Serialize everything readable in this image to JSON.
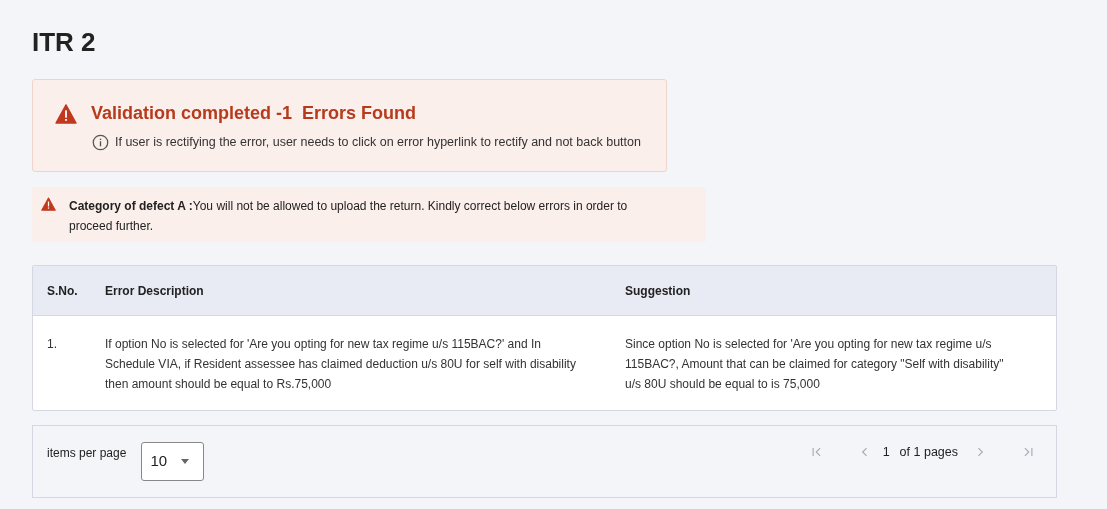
{
  "title": "ITR 2",
  "alert": {
    "heading": "Validation completed -1  Errors Found",
    "note": "If user is rectifying the error, user needs to click on error hyperlink to rectify and not back button"
  },
  "defect": {
    "text": "**Category of defect A :**You will not be allowed to upload the return. Kindly correct below errors in order to proceed further."
  },
  "table": {
    "columns": [
      "S.No.",
      "Error Description",
      "Suggestion"
    ],
    "rows": [
      [
        "1.",
        "If option No is selected for 'Are you opting for new tax regime u/s 115BAC?' and In Schedule VIA, if Resident assessee has claimed deduction u/s 80U for self with disability then amount should be equal to Rs.75,000",
        "Since option No is selected for 'Are you opting for new tax regime u/s 115BAC?, Amount that can be claimed for category \"Self with disability\" u/s 80U should be equal to is 75,000"
      ]
    ]
  },
  "pagination": {
    "items_label": "items per page",
    "page_size": "10",
    "page": "1",
    "page_total": "of 1 pages",
    "nav": [
      {
        "kind": "first",
        "disabled": true
      },
      {
        "kind": "prev",
        "disabled": true
      },
      {
        "kind": "next",
        "disabled": true
      },
      {
        "kind": "last",
        "disabled": true
      }
    ]
  }
}
